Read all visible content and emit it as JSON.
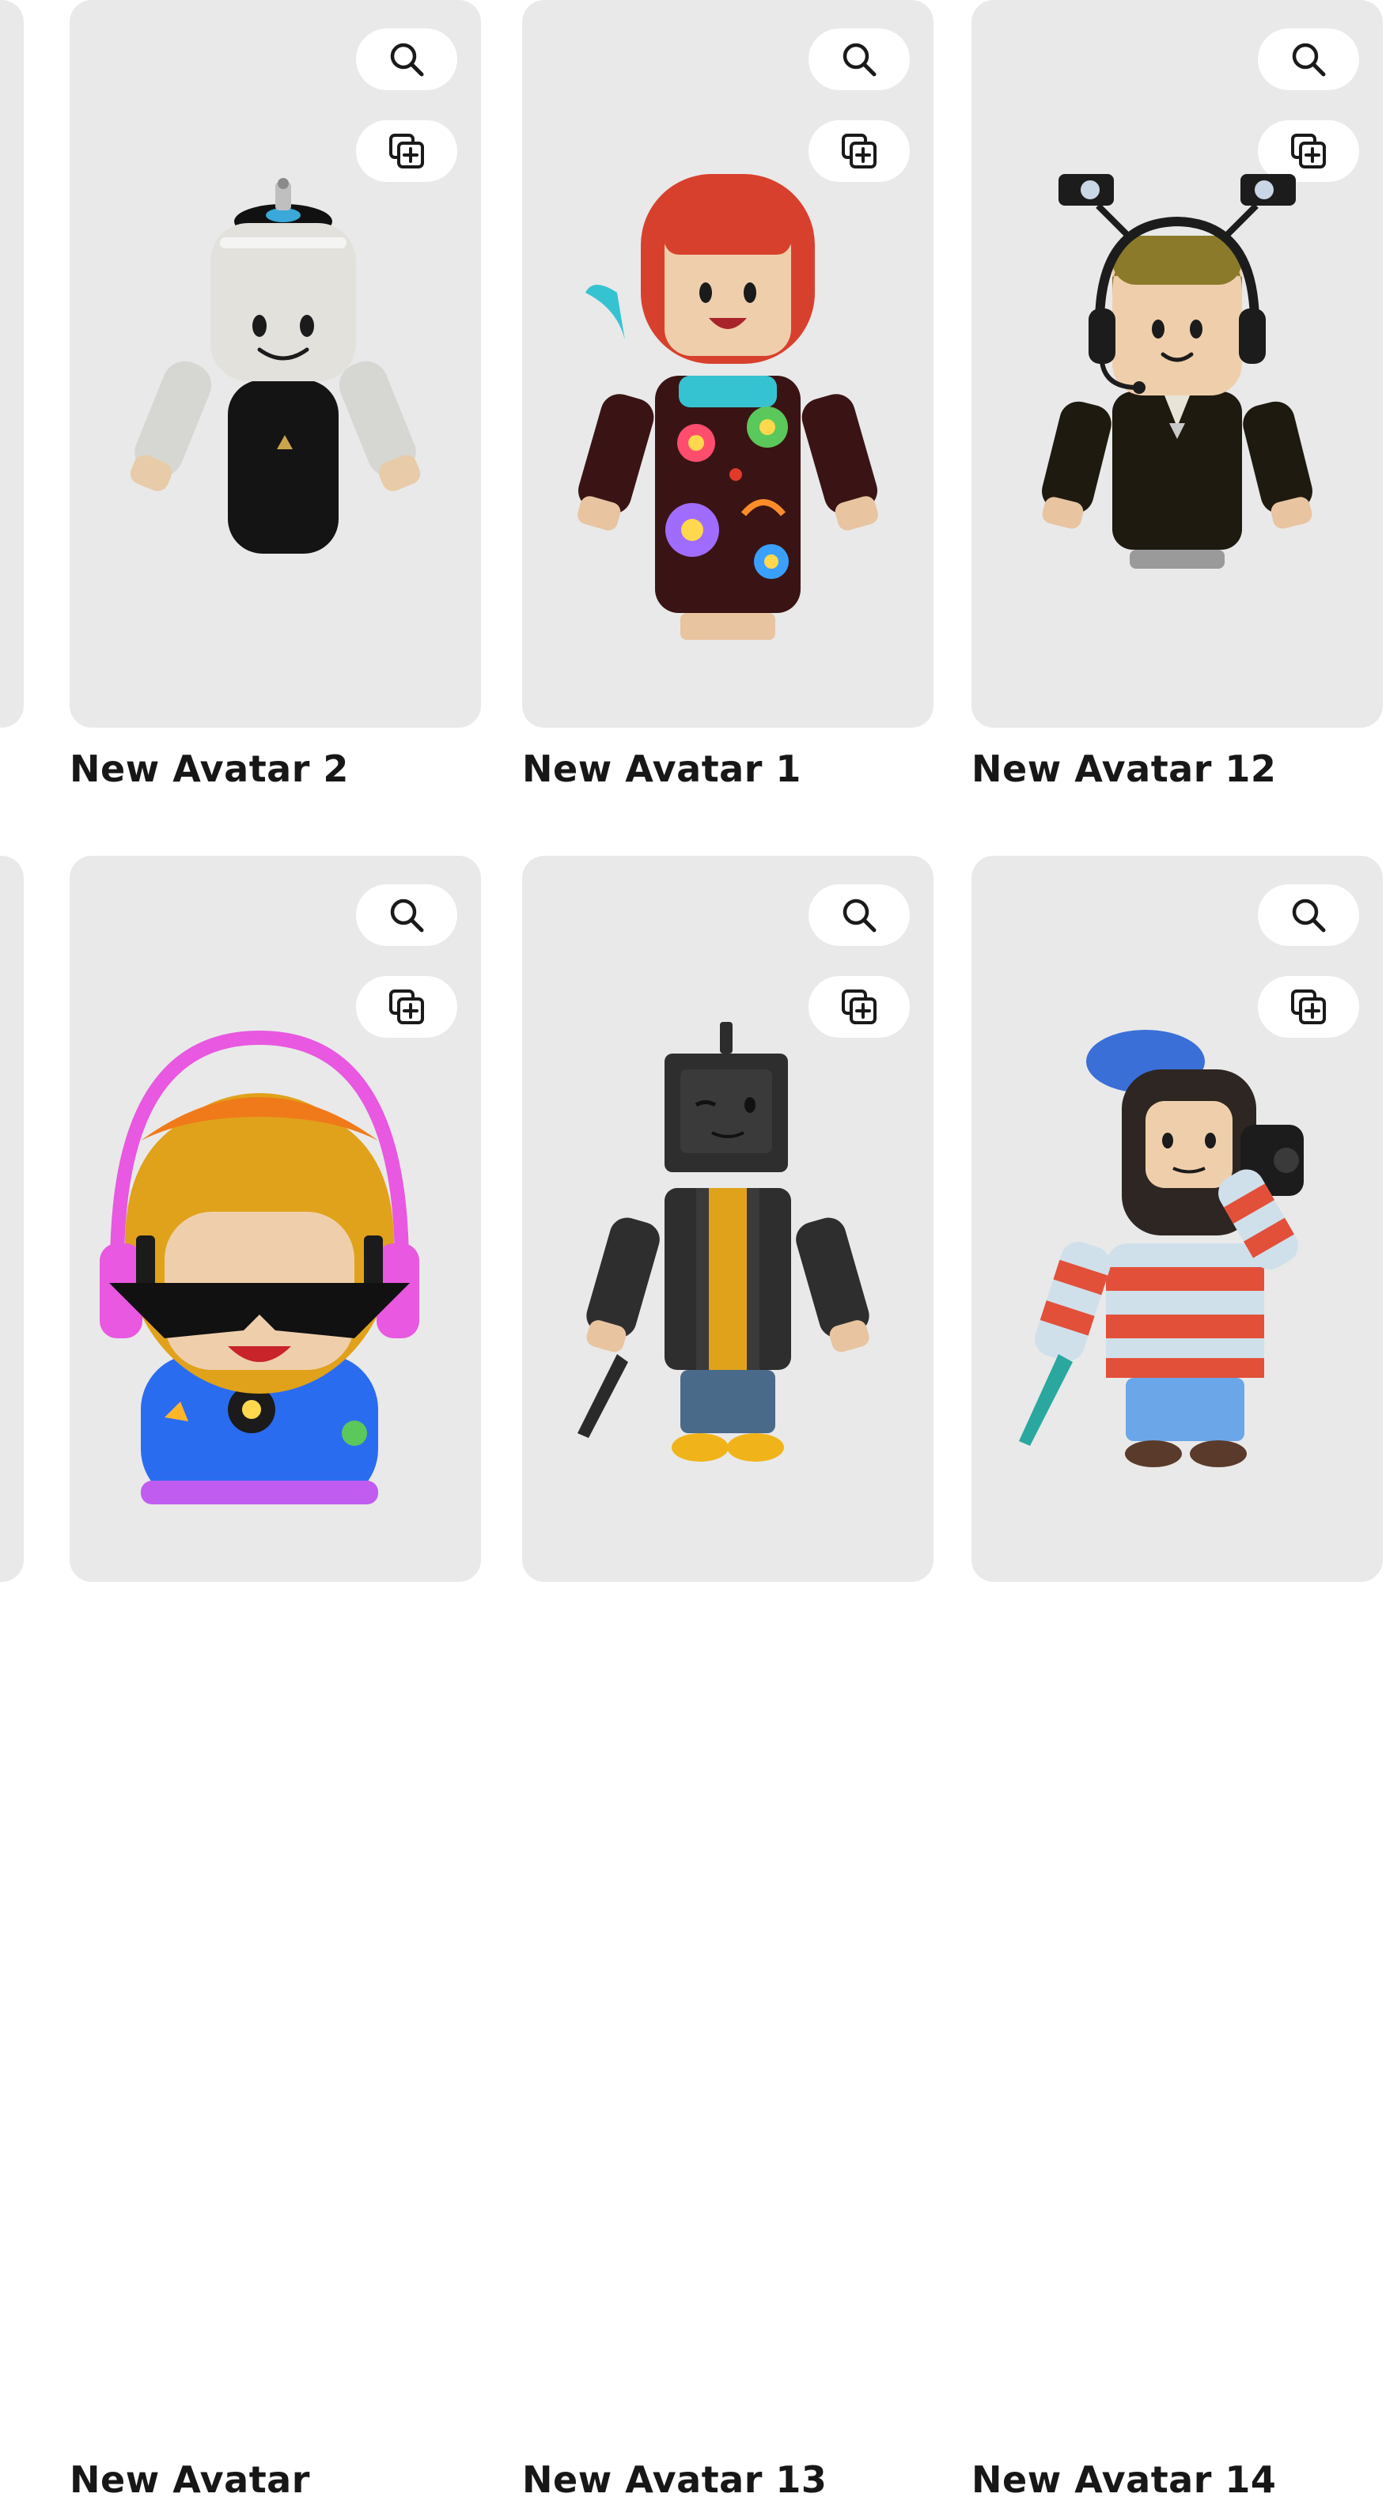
{
  "avatars": [
    {
      "name": "New Avatar 2",
      "figure_icon": "spray-can-avatar-icon"
    },
    {
      "name": "New Avatar 1",
      "figure_icon": "red-bob-hair-flower-dress-avatar-icon"
    },
    {
      "name": "New Avatar 12",
      "figure_icon": "headset-spotlight-suit-avatar-icon"
    },
    {
      "name": "New Avatar",
      "figure_icon": "pink-headphones-sunglasses-avatar-icon"
    },
    {
      "name": "New Avatar 13",
      "figure_icon": "tv-head-jacket-avatar-icon"
    },
    {
      "name": "New Avatar 14",
      "figure_icon": "beret-beard-camera-avatar-icon"
    }
  ],
  "actions": {
    "zoom_icon": "magnifier-icon",
    "add_icon": "copy-add-icon"
  },
  "colors": {
    "card_background": "#e9e9e9",
    "button_background": "#ffffff",
    "text": "#171717"
  }
}
